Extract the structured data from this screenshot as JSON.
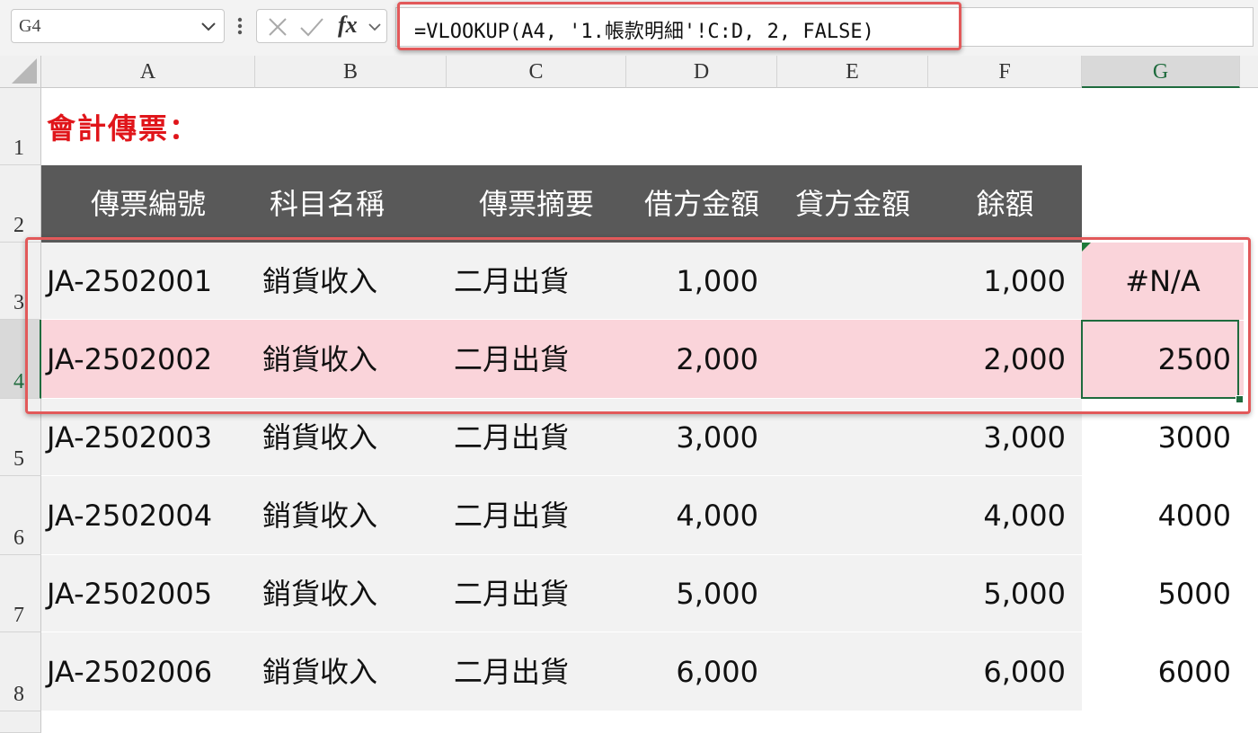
{
  "formula_bar": {
    "name_box": "G4",
    "cancel_icon": "cancel-icon",
    "confirm_icon": "confirm-icon",
    "fx_label": "fx",
    "formula": "=VLOOKUP(A4, '1.帳款明細'!C:D, 2, FALSE)"
  },
  "column_headers": [
    "A",
    "B",
    "C",
    "D",
    "E",
    "F",
    "G"
  ],
  "selected_column": "G",
  "row_headers": [
    "1",
    "2",
    "3",
    "4",
    "5",
    "6",
    "7",
    "8"
  ],
  "selected_row": "4",
  "sheet": {
    "title": "會計傳票：",
    "headers": [
      "傳票編號",
      "科目名稱",
      "傳票摘要",
      "借方金額",
      "貸方金額",
      "餘額"
    ],
    "rows": [
      {
        "id": "JA-2502001",
        "account": "銷貨收入",
        "summary": "二月出貨",
        "debit": "1,000",
        "credit": "",
        "balance": "1,000",
        "lookup": "#N/A"
      },
      {
        "id": "JA-2502002",
        "account": "銷貨收入",
        "summary": "二月出貨",
        "debit": "2,000",
        "credit": "",
        "balance": "2,000",
        "lookup": "2500"
      },
      {
        "id": "JA-2502003",
        "account": "銷貨收入",
        "summary": "二月出貨",
        "debit": "3,000",
        "credit": "",
        "balance": "3,000",
        "lookup": "3000"
      },
      {
        "id": "JA-2502004",
        "account": "銷貨收入",
        "summary": "二月出貨",
        "debit": "4,000",
        "credit": "",
        "balance": "4,000",
        "lookup": "4000"
      },
      {
        "id": "JA-2502005",
        "account": "銷貨收入",
        "summary": "二月出貨",
        "debit": "5,000",
        "credit": "",
        "balance": "5,000",
        "lookup": "5000"
      },
      {
        "id": "JA-2502006",
        "account": "銷貨收入",
        "summary": "二月出貨",
        "debit": "6,000",
        "credit": "",
        "balance": "6,000",
        "lookup": "6000"
      }
    ]
  },
  "colors": {
    "title": "#e0151a",
    "header_bg": "#595959",
    "row_bg": "#f2f2f2",
    "highlight_row": "#fad4da",
    "annotation_border": "#e2595a",
    "selection": "#1e6b3d"
  }
}
